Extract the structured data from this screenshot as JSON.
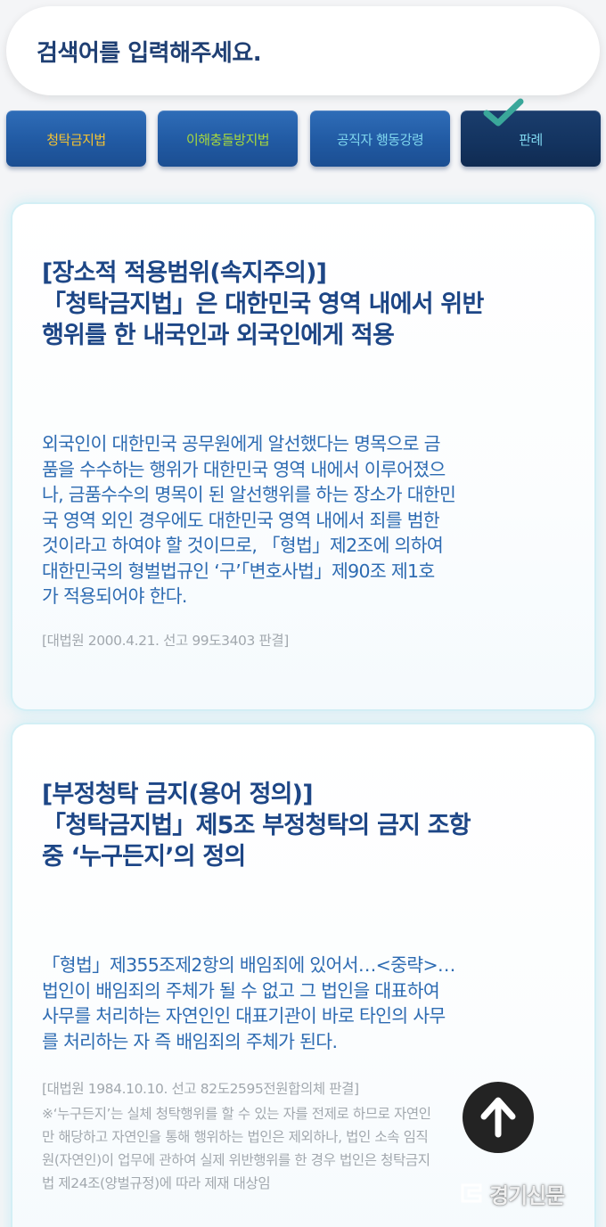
{
  "search": {
    "placeholder": "검색어를 입력해주세요."
  },
  "tabs": [
    {
      "label": "청탁금지법",
      "color": "#f6c331",
      "selected": false
    },
    {
      "label": "이해충돌방지법",
      "color": "#a7d83c",
      "selected": false
    },
    {
      "label": "공직자 행동강령",
      "color": "#7fd6ee",
      "selected": false
    },
    {
      "label": "판례",
      "color": "#7fd6ee",
      "selected": true
    }
  ],
  "selected_tab_icon": "checkmark-icon",
  "cards": [
    {
      "title_lines": [
        "[장소적 적용범위(속지주의)]",
        "「청탁금지법」은 대한민국 영역 내에서 위반",
        "행위를 한 내국인과 외국인에게 적용"
      ],
      "body_lines": [
        "외국인이 대한민국 공무원에게 알선했다는 명목으로 금",
        "품을 수수하는 행위가 대한민국 영역 내에서 이루어졌으",
        "나, 금품수수의 명목이 된 알선행위를 하는 장소가 대한민",
        "국 영역 외인 경우에도 대한민국 영역 내에서 죄를 범한",
        "것이라고 하여야 할 것이므로, 「형법」제2조에 의하여",
        "대한민국의 형벌법규인 ‘구’「변호사법」제90조 제1호",
        "가 적용되어야 한다."
      ],
      "citation_lines": [
        "[대법원 2000.4.21. 선고 99도3403 판결]"
      ]
    },
    {
      "title_lines": [
        "[부정청탁 금지(용어 정의)]",
        "「청탁금지법」제5조 부정청탁의 금지 조항",
        "중 ‘누구든지’의 정의"
      ],
      "body_lines": [
        "「형법」제355조제2항의 배임죄에 있어서…<중략>…",
        "법인이 배임죄의 주체가 될 수 없고 그 법인을 대표하여",
        "사무를 처리하는 자연인인 대표기관이 바로 타인의 사무",
        "를 처리하는 자 즉 배임죄의 주체가 된다."
      ],
      "citation_lines": [
        "[대법원 1984.10.10. 선고 82도2595전원합의체 판결]"
      ],
      "note_lines": [
        "※‘누구든지’는 실체 청탁행위를 할 수 있는 자를 전제로 하므로 자연인",
        "만 해당하고 자연인을 통해 행위하는 법인은 제외하나, 법인 소속 임직",
        "원(자연인)이 업무에 관하여 실제 위반행위를 한 경우 법인은 청탁금지",
        "법 제24조(양벌규정)에 따라 제재 대상임"
      ]
    }
  ],
  "scroll_top": {
    "icon": "arrow-up-icon"
  },
  "watermark": {
    "text": "경기신문",
    "icon": "logo-mark-icon"
  }
}
